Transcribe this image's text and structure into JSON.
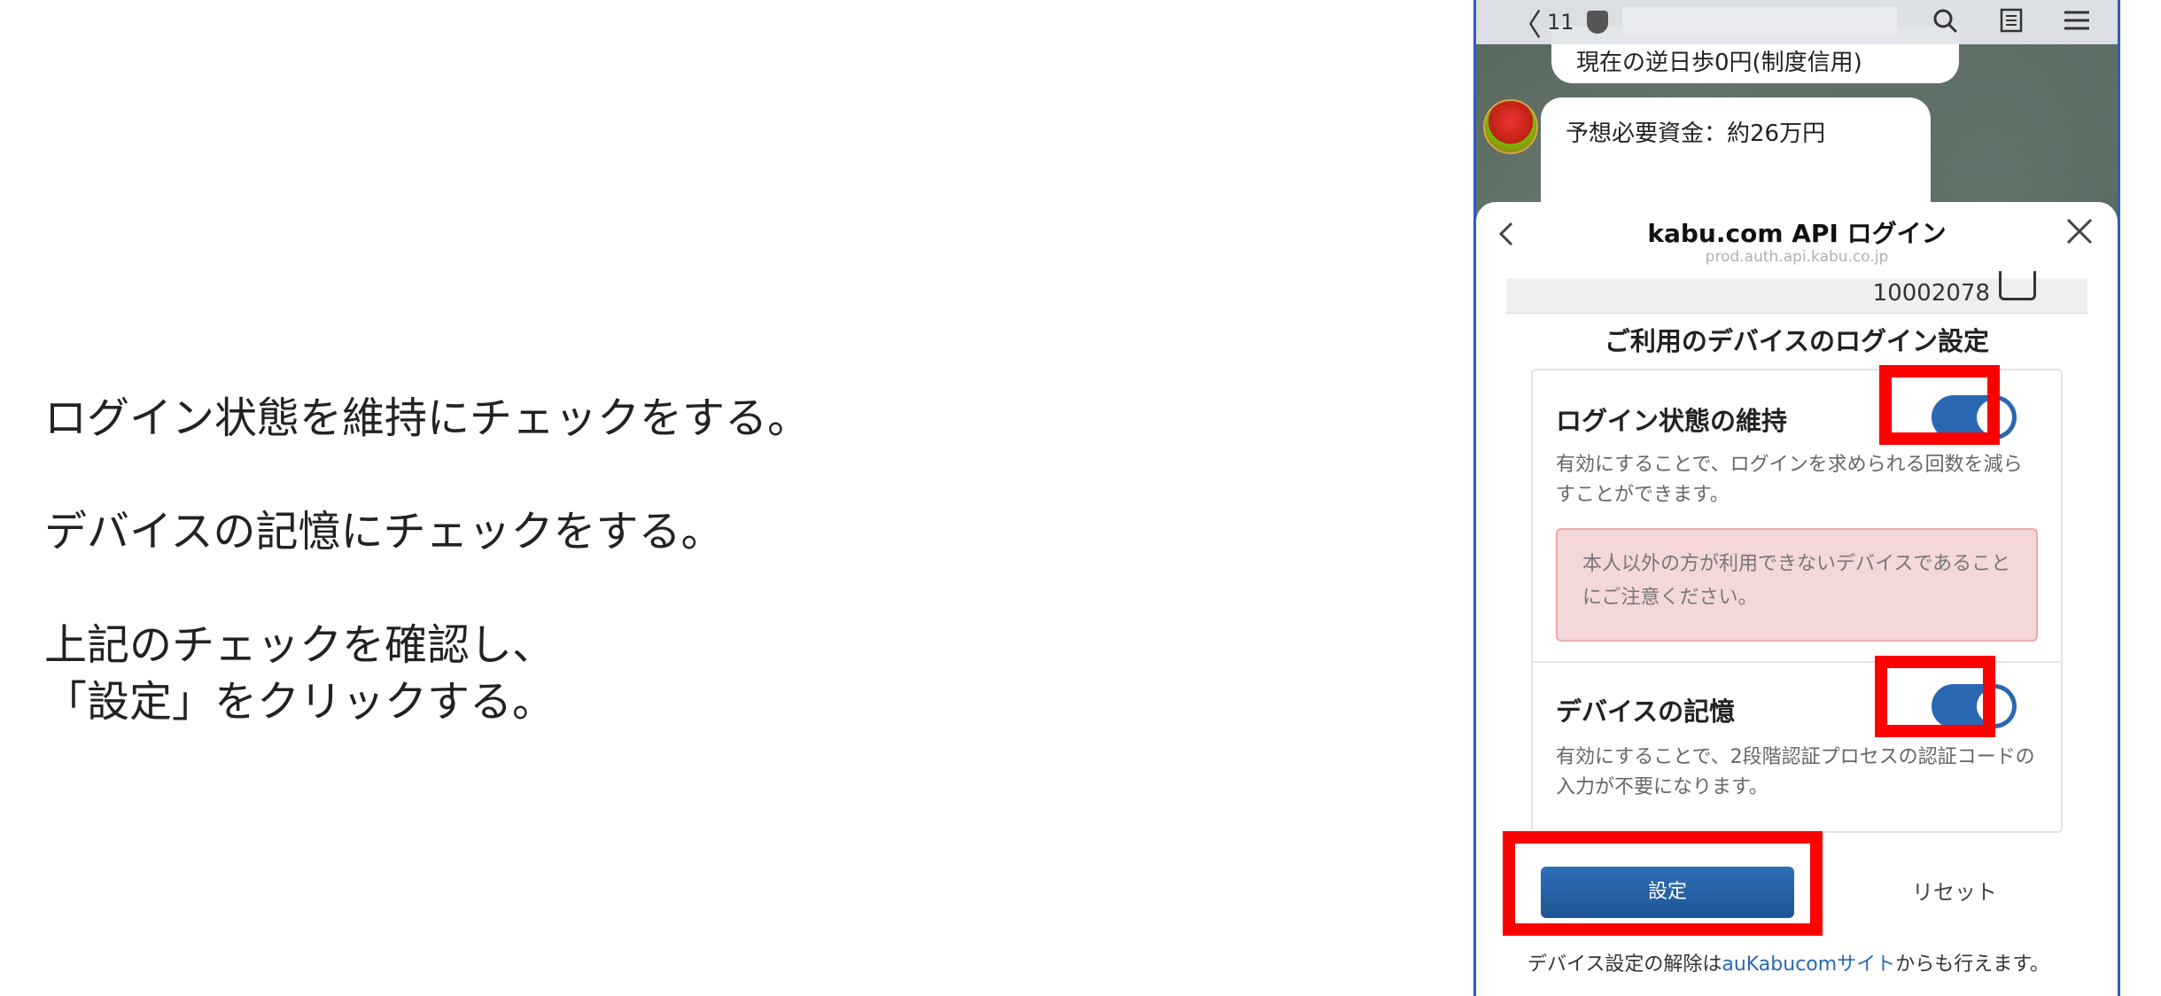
{
  "instructions": {
    "line1": "ログイン状態を維持にチェックをする。",
    "line2": "デバイスの記憶にチェックをする。",
    "line3": "上記のチェックを確認し、",
    "line4": "「設定」をクリックする。"
  },
  "browser": {
    "back_glyph": "〈",
    "tab_count": "11"
  },
  "chat": {
    "bubble_top_text": "現在の逆日歩0円(制度信用)",
    "bubble_text": "予想必要資金：約26万円"
  },
  "modal": {
    "title": "kabu.com API ログイン",
    "url": "prod.auth.api.kabu.co.jp",
    "id_value": "10002078",
    "section_title": "ご利用のデバイスのログイン設定",
    "setting1": {
      "title": "ログイン状態の維持",
      "description": "有効にすることで、ログインを求められる回数を減らすことができます。",
      "enabled": true
    },
    "warning": "本人以外の方が利用できないデバイスであることにご注意ください。",
    "setting2": {
      "title": "デバイスの記憶",
      "description": "有効にすることで、2段階認証プロセスの認証コードの入力が不要になります。",
      "enabled": true
    },
    "set_button": "設定",
    "reset_button": "リセット",
    "footer_prefix": "デバイス設定の解除は",
    "footer_link": "auKabucomサイト",
    "footer_suffix": "からも行えます。"
  },
  "colors": {
    "highlight": "#ff0000",
    "toggle_on": "#2a68b3",
    "primary_button": "#2a68b3"
  },
  "icons": [
    "back-chevron-icon",
    "shield-icon",
    "search-icon",
    "reader-icon",
    "menu-icon",
    "chevron-left-icon",
    "close-icon",
    "calendar-icon"
  ]
}
